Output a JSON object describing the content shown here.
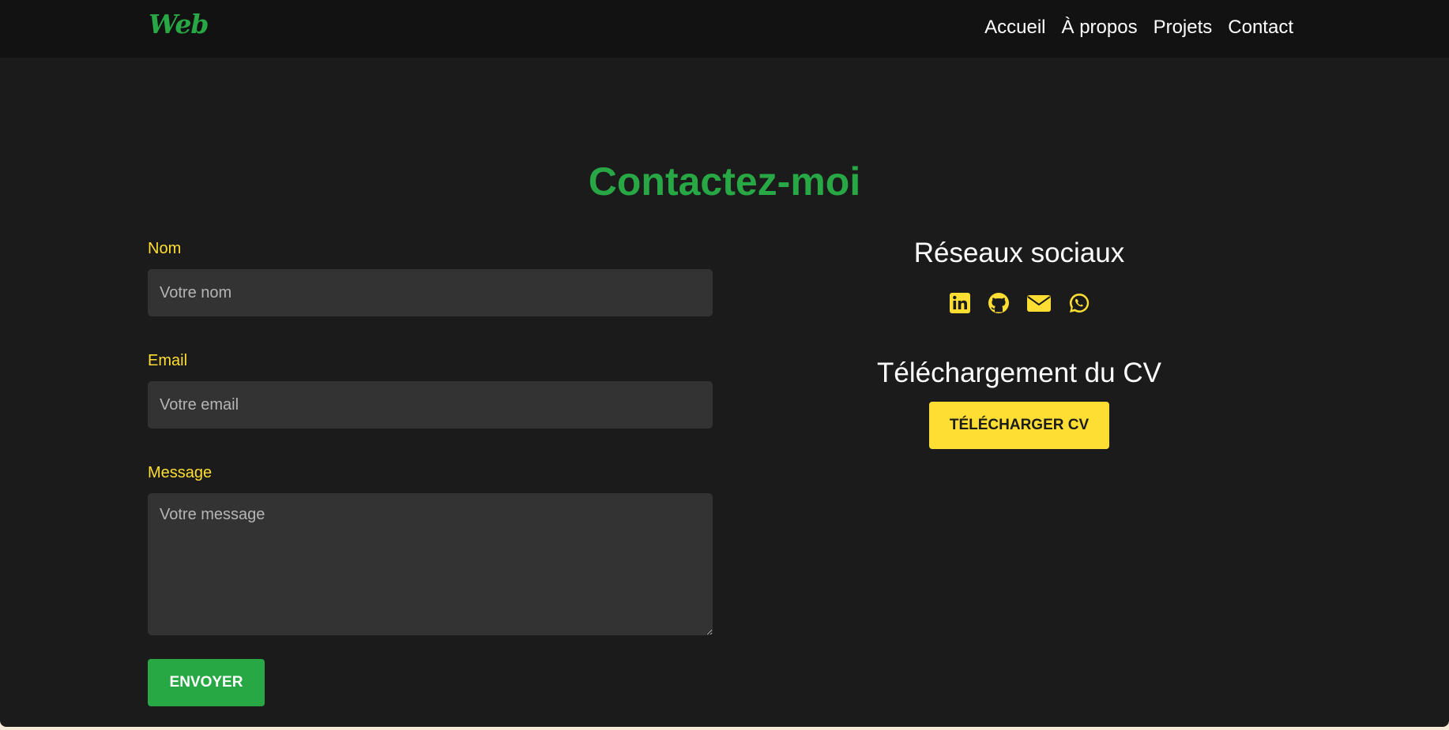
{
  "nav": {
    "logo": "Web",
    "links": [
      "Accueil",
      "À propos",
      "Projets",
      "Contact"
    ]
  },
  "page": {
    "title": "Contactez-moi"
  },
  "form": {
    "name_label": "Nom",
    "name_placeholder": "Votre nom",
    "email_label": "Email",
    "email_placeholder": "Votre email",
    "message_label": "Message",
    "message_placeholder": "Votre message",
    "submit_label": "ENVOYER"
  },
  "social": {
    "heading": "Réseaux sociaux",
    "icons": [
      "linkedin-icon",
      "github-icon",
      "envelope-icon",
      "whatsapp-icon"
    ]
  },
  "cv": {
    "heading": "Téléchargement du CV",
    "button_label": "TÉLÉCHARGER CV"
  },
  "colors": {
    "accent_green": "#28a745",
    "accent_yellow": "#ffde33",
    "background": "#1b1b1b",
    "navbar": "#121212",
    "input_background": "#333333"
  }
}
